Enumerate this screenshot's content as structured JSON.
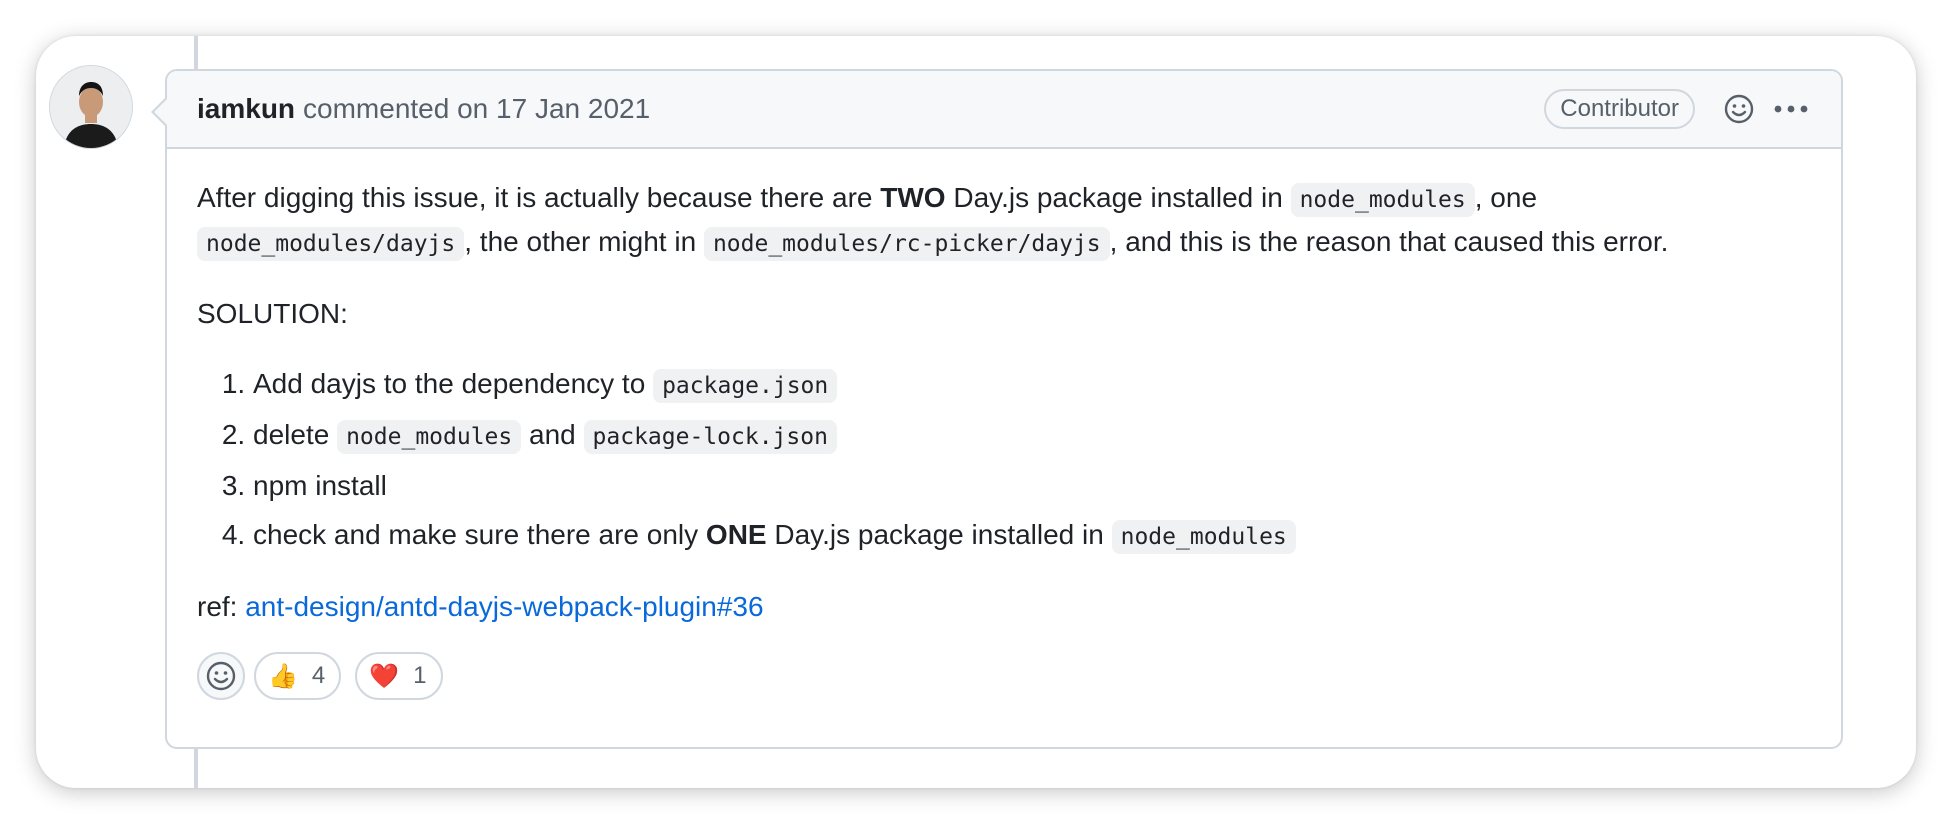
{
  "comment": {
    "author": "iamkun",
    "meta": "commented on 17 Jan 2021",
    "badge": "Contributor",
    "intro": {
      "t1": "After digging this issue, it is actually because there are ",
      "b1": "TWO",
      "t2": " Day.js package installed in ",
      "c1": "node_modules",
      "t3": ", one ",
      "c2": "node_modules/dayjs",
      "t4": ", the other might in ",
      "c3": "node_modules/rc-picker/dayjs",
      "t5": ", and this is the reason that caused this error."
    },
    "solution_heading": "SOLUTION:",
    "steps": [
      {
        "text": "Add dayjs to the dependency to ",
        "code": "package.json"
      },
      {
        "text": "delete ",
        "code": "node_modules",
        "text2": " and ",
        "code2": " package-lock.json"
      },
      {
        "text": "npm install"
      },
      {
        "text": "check and make sure there are only ",
        "bold": "ONE",
        "text2": " Day.js package installed in ",
        "code": "node_modules"
      }
    ],
    "ref_label": "ref: ",
    "ref_link": "ant-design/antd-dayjs-webpack-plugin#36",
    "reactions": [
      {
        "emoji": "👍",
        "icon": "thumbs-up",
        "count": "4"
      },
      {
        "emoji": "❤️",
        "icon": "heart",
        "count": "1"
      }
    ]
  },
  "icons": {
    "add_reaction": "smiley-icon",
    "more": "kebab-horizontal-icon"
  },
  "colors": {
    "link": "#0969da",
    "header_bg": "#f6f8fa",
    "border": "#d0d7de",
    "code_bg": "#eff1f3"
  }
}
